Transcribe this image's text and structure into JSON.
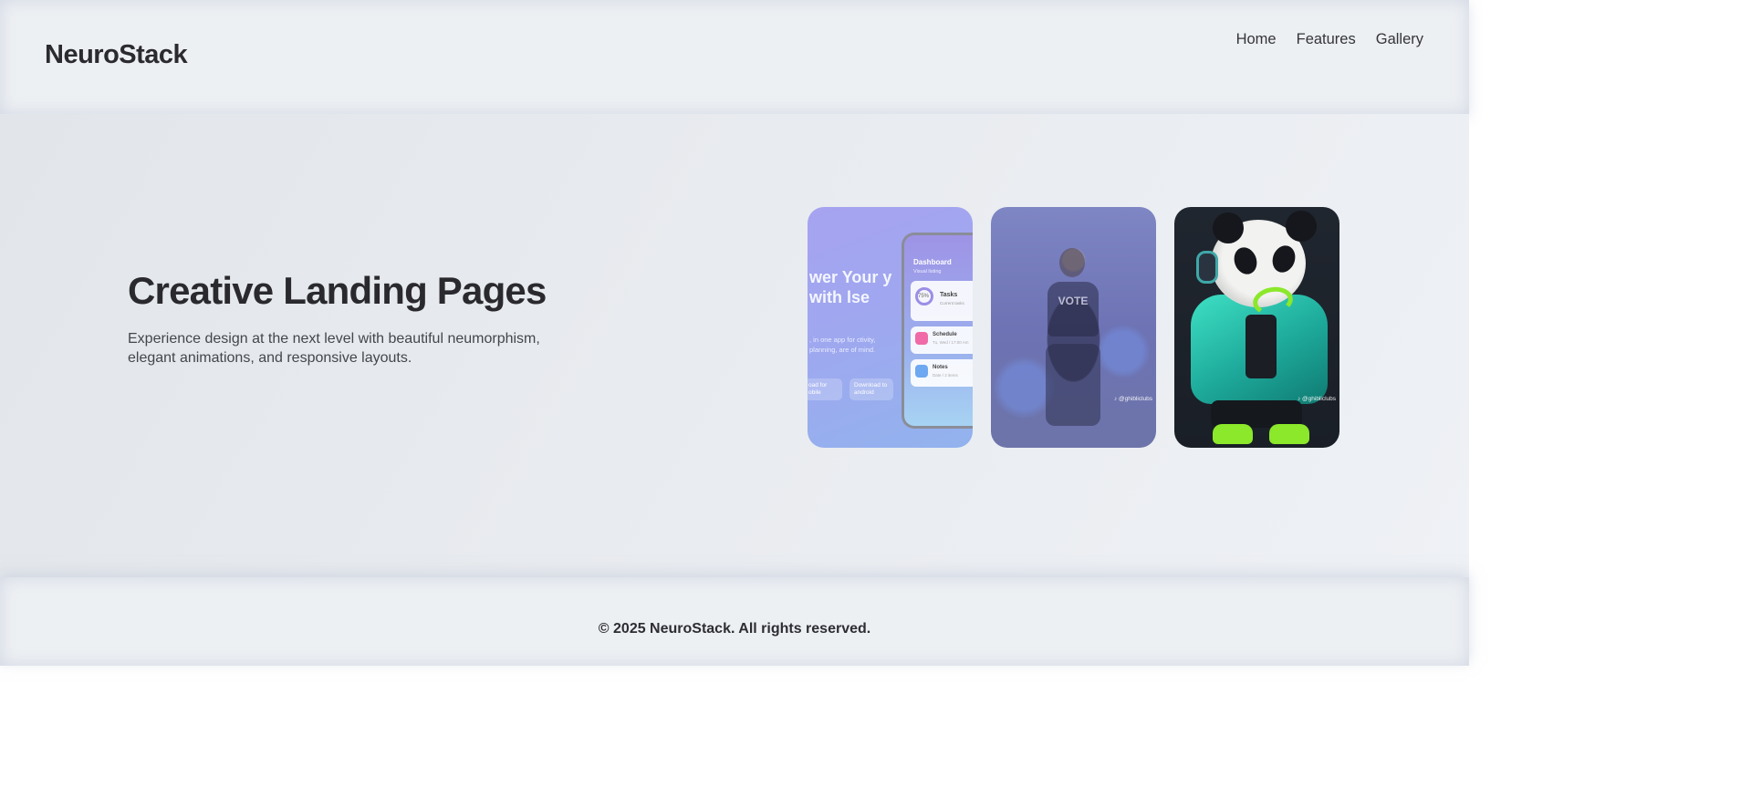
{
  "header": {
    "brand": "NeuroStack",
    "nav": [
      "Home",
      "Features",
      "Gallery"
    ]
  },
  "hero": {
    "title": "Creative Landing Pages",
    "subtitle": "Experience design at the next level with beautiful neumorphism, elegant animations, and responsive layouts."
  },
  "gallery": {
    "app_card": {
      "headline": "wer Your y with lse",
      "blurb": ", in one app for ctivity, planning, are of mind.",
      "cta_left": "oad for obile",
      "cta_right": "Download to android",
      "phone_title": "Dashboard",
      "phone_subtitle": "Visual listing",
      "widget_tasks_title": "Tasks",
      "widget_tasks_sub": "Current tasks",
      "widget_tasks_percent": "75%",
      "widget_schedule_title": "Schedule",
      "widget_schedule_meta": "Tu, Wed / 17:00 Am",
      "widget_notes_title": "Notes",
      "widget_notes_meta": "Date / 2 items"
    },
    "photo_card": {
      "shirt_text": "VOTE",
      "watermark": "♪ @ghibliclubs"
    },
    "panda_card": {
      "watermark": "♪ @ghibliclubs"
    }
  },
  "footer": {
    "text": "© 2025 NeuroStack. All rights reserved."
  },
  "colors": {
    "background": "#e9ecf0",
    "text": "#2b2b2f",
    "accent_teal": "#3ee0c4",
    "accent_lime": "#8be82a"
  }
}
